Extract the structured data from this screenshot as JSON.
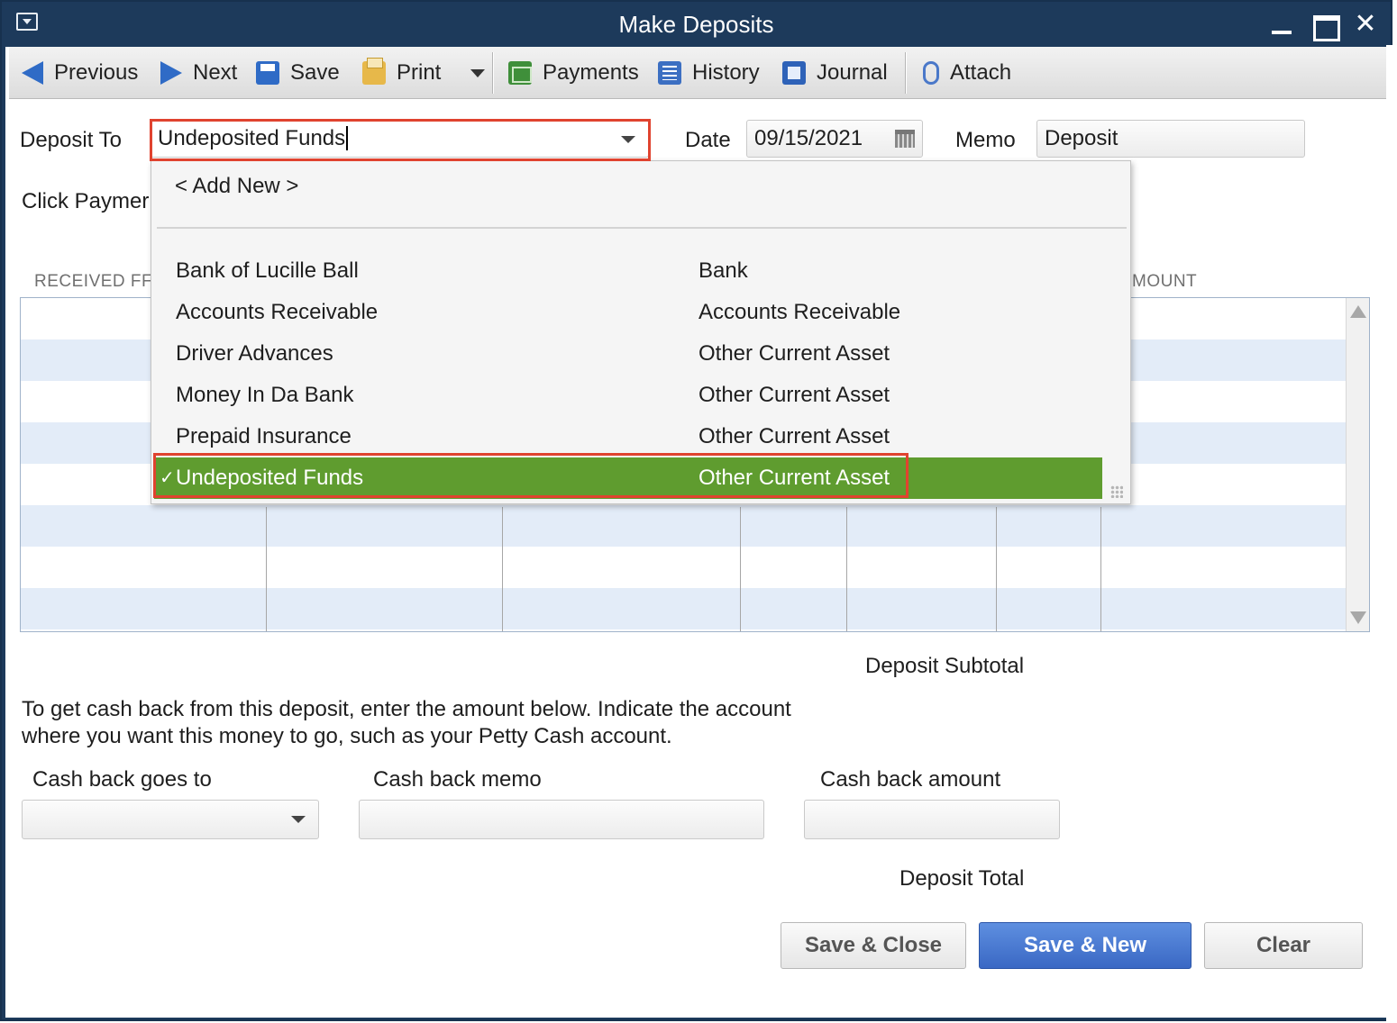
{
  "window": {
    "title": "Make Deposits"
  },
  "toolbar": {
    "previous": "Previous",
    "next": "Next",
    "save": "Save",
    "print": "Print",
    "payments": "Payments",
    "history": "History",
    "journal": "Journal",
    "attach": "Attach"
  },
  "form": {
    "deposit_to_label": "Deposit To",
    "deposit_to_value": "Undeposited Funds",
    "date_label": "Date",
    "date_value": "09/15/2021",
    "memo_label": "Memo",
    "memo_value": "Deposit",
    "click_payments_text": "Click Paymer",
    "column_received_from": "RECEIVED FF",
    "column_amount": "MOUNT"
  },
  "dropdown": {
    "add_new": "< Add New >",
    "accounts": [
      {
        "name": "Bank of Lucille Ball",
        "type": "Bank"
      },
      {
        "name": "Accounts Receivable",
        "type": "Accounts Receivable"
      },
      {
        "name": "Driver Advances",
        "type": "Other Current Asset"
      },
      {
        "name": "Money In Da Bank",
        "type": "Other Current Asset"
      },
      {
        "name": "Prepaid Insurance",
        "type": "Other Current Asset"
      },
      {
        "name": "Undeposited Funds",
        "type": "Other Current Asset",
        "selected": true
      }
    ],
    "check_mark": "✓",
    "selected_color": "#5f9c2f"
  },
  "summary": {
    "deposit_subtotal_label": "Deposit Subtotal",
    "cash_back_instructions_line1": "To get cash back from this deposit, enter the amount below.  Indicate the account",
    "cash_back_instructions_line2": "where you want this money to go, such as your Petty Cash account.",
    "cash_back_goes_to_label": "Cash back goes to",
    "cash_back_memo_label": "Cash back memo",
    "cash_back_amount_label": "Cash back amount",
    "deposit_total_label": "Deposit Total"
  },
  "buttons": {
    "save_close": "Save & Close",
    "save_new": "Save & New",
    "clear": "Clear"
  },
  "colors": {
    "title_bar": "#1d3a5b",
    "highlight_box": "#e0432f",
    "primary_button": "#3a68c4",
    "grid_alt_row": "#e3ecf8"
  }
}
